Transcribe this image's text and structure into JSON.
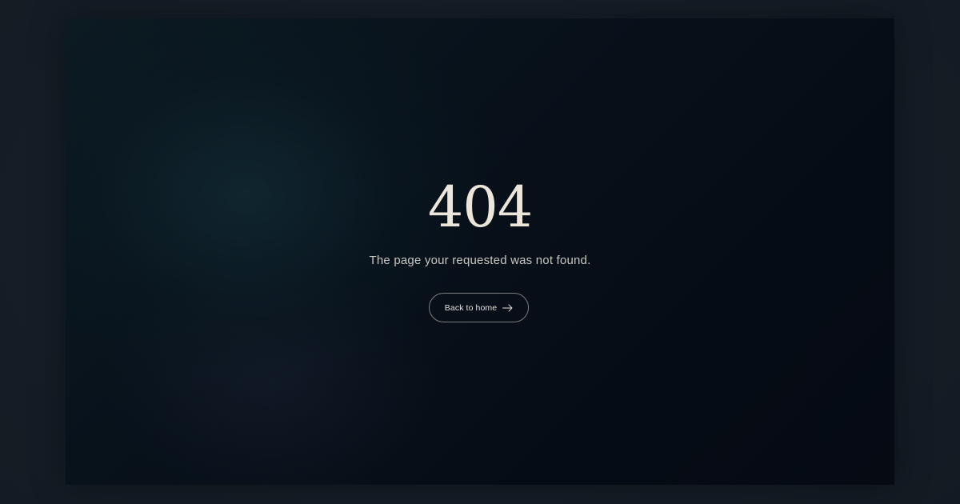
{
  "error": {
    "code": "404",
    "message": "The page your requested was not found."
  },
  "actions": {
    "home_label": "Back to home",
    "home_icon": "arrow-right-icon"
  },
  "colors": {
    "background": "#151d26",
    "panel": "#08121b",
    "text_primary": "#ece6da",
    "text_secondary": "#c9c6c0"
  }
}
